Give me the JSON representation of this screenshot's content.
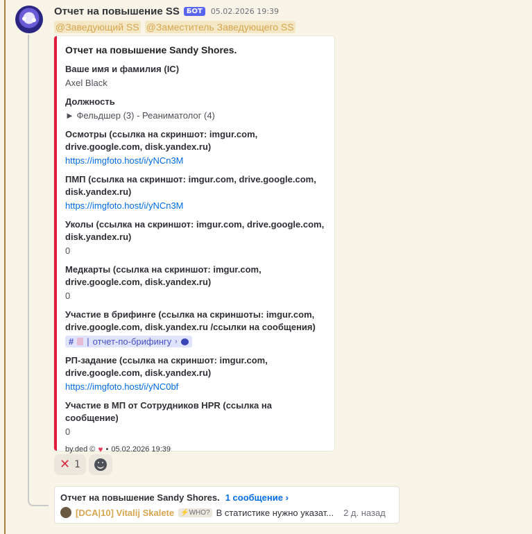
{
  "message": {
    "author": "Отчет на повышение SS",
    "bot_tag": "БОТ",
    "timestamp": "05.02.2026 19:39",
    "mentions": [
      "@Заведующий SS",
      "@Заместитель Заведующего SS"
    ]
  },
  "embed": {
    "title": "Отчет на повышение Sandy Shores.",
    "accent_color": "#e01a3c",
    "fields": [
      {
        "name": "Ваше имя и фамилия (IC)",
        "value": "Axel Black",
        "type": "text"
      },
      {
        "name": "Должность",
        "value": "► Фельдшер (3) - Реаниматолог (4)",
        "type": "text"
      },
      {
        "name": "Осмотры (ссылка на скриншот: imgur.com, drive.google.com, disk.yandex.ru)",
        "value": "https://imgfoto.host/i/yNCn3M",
        "type": "link"
      },
      {
        "name": "ПМП (ссылка на скриншот: imgur.com, drive.google.com, disk.yandex.ru)",
        "value": "https://imgfoto.host/i/yNCn3M",
        "type": "link"
      },
      {
        "name": "Уколы (ссылка на скриншот: imgur.com, drive.google.com, disk.yandex.ru)",
        "value": "0",
        "type": "text"
      },
      {
        "name": "Медкарты (ссылка на скриншот: imgur.com, drive.google.com, disk.yandex.ru)",
        "value": "0",
        "type": "text"
      },
      {
        "name": "Участие в брифинге (ссылка на скриншоты: imgur.com, drive.google.com, disk.yandex.ru /ссылки на сообщения)",
        "value": "отчет-по-брифингу",
        "type": "channel"
      },
      {
        "name": "РП-задание   (ссылка на скриншот: imgur.com, drive.google.com, disk.yandex.ru)",
        "value": "https://imgfoto.host/i/yNC0bf",
        "type": "link"
      },
      {
        "name": "Участие в МП от Сотрудников HPR (ссылка на сообщение)",
        "value": "0",
        "type": "text"
      }
    ],
    "footer": {
      "text": "by.ded ©",
      "separator": "•",
      "timestamp": "05.02.2026 19:39"
    }
  },
  "reactions": [
    {
      "emoji": "cross-mark-icon",
      "count": "1"
    },
    {
      "emoji": "add-reaction-icon",
      "count": ""
    }
  ],
  "thread": {
    "name": "Отчет на повышение Sandy Shores.",
    "count_label": "1 сообщение ›",
    "last_author": "[DCA|10] Vitalij Skalete",
    "role_badge": "WHO?",
    "last_message": "В статистике нужно указат...",
    "last_time": "2 д. назад"
  }
}
